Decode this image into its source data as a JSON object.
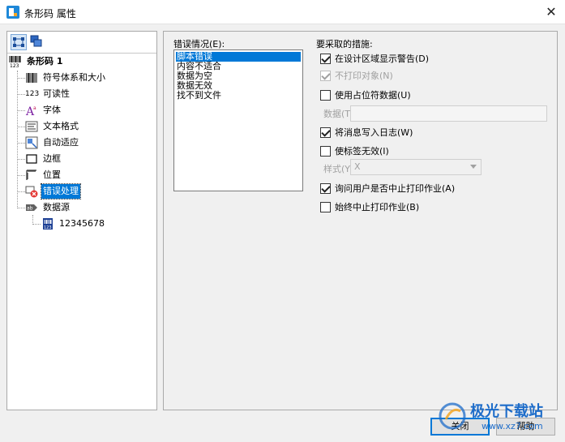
{
  "window": {
    "title": "条形码 属性",
    "close_glyph": "✕"
  },
  "tree": {
    "root": {
      "label": "条形码 1",
      "icon": "barcode-icon"
    },
    "items": [
      {
        "label": "符号体系和大小",
        "icon": "barcode-lines-icon"
      },
      {
        "label": "可读性",
        "icon": "digits-icon",
        "icon_text": "123"
      },
      {
        "label": "字体",
        "icon": "font-icon"
      },
      {
        "label": "文本格式",
        "icon": "text-format-icon"
      },
      {
        "label": "自动适应",
        "icon": "auto-fit-icon"
      },
      {
        "label": "边框",
        "icon": "border-icon"
      },
      {
        "label": "位置",
        "icon": "position-icon"
      },
      {
        "label": "错误处理",
        "icon": "error-handling-icon"
      },
      {
        "label": "数据源",
        "icon": "data-source-icon"
      }
    ],
    "sub_item": {
      "label": "12345678",
      "icon": "data-field-icon"
    }
  },
  "errors": {
    "caption": "错误情况(E):",
    "items": [
      "脚本错误",
      "内容不适合",
      "数据为空",
      "数据无效",
      "找不到文件"
    ]
  },
  "actions": {
    "caption": "要采取的措施:",
    "show_warning": "在设计区域显示警告(D)",
    "no_print": "不打印对象(N)",
    "use_placeholder": "使用占位符数据(U)",
    "data_label": "数据(T):",
    "write_log": "将消息写入日志(W)",
    "invalidate": "使标签无效(I)",
    "style_label": "样式(Y):",
    "style_value": "X",
    "ask_user": "询问用户是否中止打印作业(A)",
    "always_abort": "始终中止打印作业(B)"
  },
  "buttons": {
    "close": "关闭",
    "help": "帮助"
  },
  "watermark": {
    "title": "极光下载站",
    "url": "www.xz7.com"
  },
  "colors": {
    "accent": "#0078d7",
    "brand": "#1d6cc9"
  }
}
